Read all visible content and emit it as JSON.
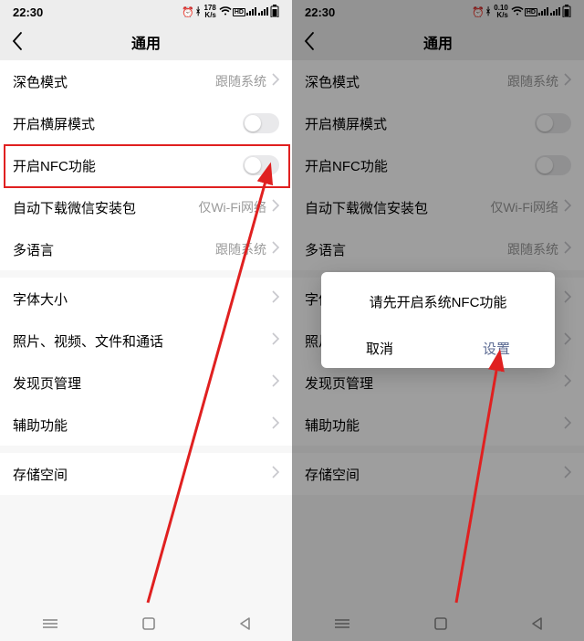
{
  "status": {
    "time": "22:30",
    "net_speed_top": "178",
    "net_speed_top_r": "0.10",
    "net_unit": "K/s",
    "hd": "HD"
  },
  "header": {
    "title": "通用"
  },
  "rows": {
    "dark": {
      "label": "深色模式",
      "value": "跟随系统"
    },
    "landscape": {
      "label": "开启横屏模式"
    },
    "nfc": {
      "label": "开启NFC功能"
    },
    "autodl": {
      "label": "自动下载微信安装包",
      "value": "仅Wi-Fi网络"
    },
    "lang": {
      "label": "多语言",
      "value": "跟随系统"
    },
    "font": {
      "label": "字体大小"
    },
    "media": {
      "label": "照片、视频、文件和通话"
    },
    "discover": {
      "label": "发现页管理"
    },
    "access": {
      "label": "辅助功能"
    },
    "storage": {
      "label": "存储空间"
    }
  },
  "dialog": {
    "msg": "请先开启系统NFC功能",
    "cancel": "取消",
    "go": "设置"
  }
}
